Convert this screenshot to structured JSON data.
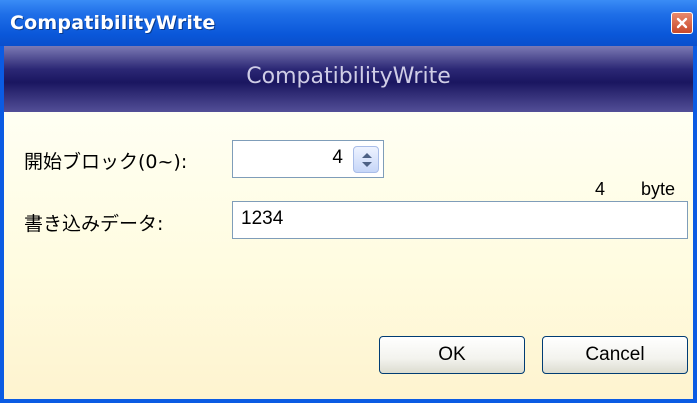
{
  "window": {
    "title": "CompatibilityWrite",
    "close_icon": "close-icon"
  },
  "banner": {
    "title": "CompatibilityWrite"
  },
  "form": {
    "start_block_label": "開始ブロック(0~):",
    "start_block_value": "4",
    "data_label": "書き込みデータ:",
    "data_value": "1234",
    "size_value": "4",
    "size_unit": "byte"
  },
  "buttons": {
    "ok": "OK",
    "cancel": "Cancel"
  },
  "colors": {
    "titlebar": "#0a57d9",
    "banner": "#1a1660",
    "panel": "#fffce0"
  }
}
